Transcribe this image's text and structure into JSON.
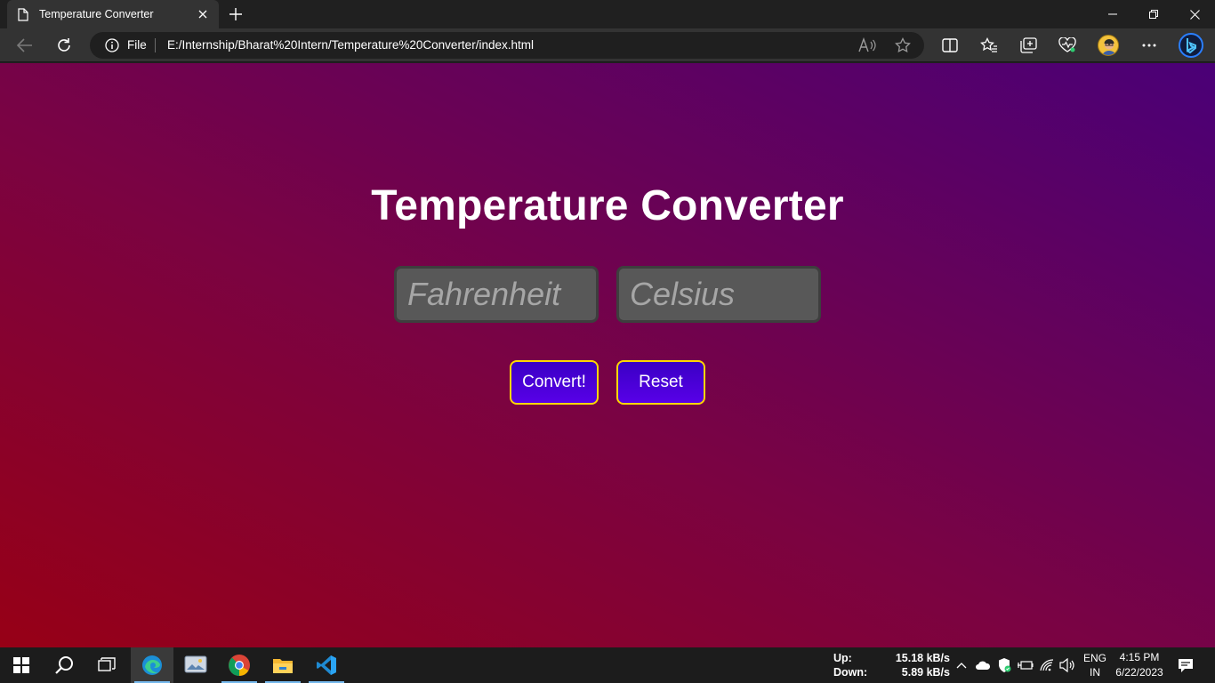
{
  "browser": {
    "tab_title": "Temperature Converter",
    "address_prefix": "File",
    "url": "E:/Internship/Bharat%20Intern/Temperature%20Converter/index.html"
  },
  "page": {
    "title": "Temperature Converter",
    "fahrenheit_placeholder": "Fahrenheit",
    "fahrenheit_value": "",
    "celsius_placeholder": "Celsius",
    "celsius_value": "",
    "convert_label": "Convert!",
    "reset_label": "Reset"
  },
  "colors": {
    "gradient_start": "#970016",
    "gradient_end": "#4a0077",
    "button_border": "#ffd700",
    "button_fill": "#4a00dd",
    "input_fill": "#585858"
  },
  "taskbar": {
    "apps": [
      "start-icon",
      "search-icon",
      "task-view-icon",
      "edge-icon",
      "photos-icon",
      "chrome-icon",
      "file-explorer-icon",
      "vscode-icon"
    ],
    "net_up_label": "Up:",
    "net_up_value": "15.18 kB/s",
    "net_down_label": "Down:",
    "net_down_value": "5.89 kB/s",
    "lang_top": "ENG",
    "lang_bottom": "IN",
    "time": "4:15 PM",
    "date": "6/22/2023"
  }
}
